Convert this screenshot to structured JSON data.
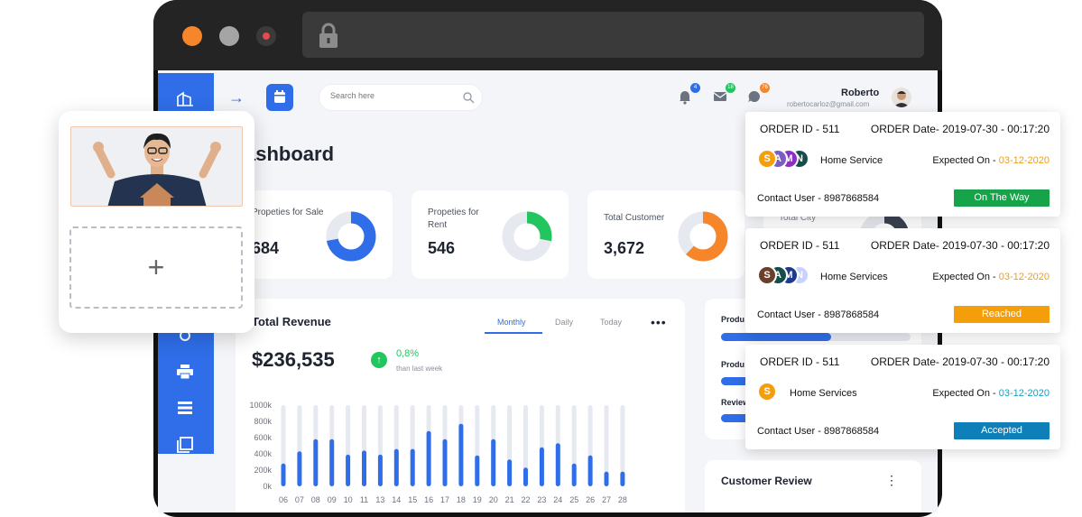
{
  "window": {
    "lock_icon": "lock-icon"
  },
  "header": {
    "search_placeholder": "Search here",
    "notifications": {
      "bell_badge": "4",
      "mail_badge": "18",
      "chat_badge": "76"
    },
    "user": {
      "name": "Roberto",
      "email": "robertocarloz@gmail.com"
    }
  },
  "page": {
    "title": "ashboard"
  },
  "stats": [
    {
      "label": "Propeties for Sale",
      "value": "684",
      "donut_fraction": 0.72,
      "color": "#2f6ee8"
    },
    {
      "label": "Propeties for Rent",
      "value": "546",
      "donut_fraction": 0.28,
      "color": "#22c55e"
    },
    {
      "label": "Total Customer",
      "value": "3,672",
      "donut_fraction": 0.62,
      "color": "#f7852a"
    }
  ],
  "partial_stat_label": "Total City",
  "revenue": {
    "title": "Total Revenue",
    "tabs": [
      "Monthly",
      "Daily",
      "Today"
    ],
    "active_tab": "Monthly",
    "amount": "$236,535",
    "change": "0,8%",
    "change_note": "than last week"
  },
  "chart_data": {
    "type": "bar",
    "categories": [
      "06",
      "07",
      "08",
      "09",
      "10",
      "11",
      "13",
      "14",
      "15",
      "16",
      "17",
      "18",
      "19",
      "20",
      "21",
      "22",
      "23",
      "24",
      "25",
      "26",
      "27",
      "28"
    ],
    "values": [
      280,
      430,
      580,
      580,
      390,
      440,
      390,
      460,
      460,
      680,
      580,
      770,
      380,
      580,
      330,
      230,
      480,
      530,
      280,
      380,
      180,
      180
    ],
    "yticks": [
      "0k",
      "200k",
      "400k",
      "600k",
      "800k",
      "1000k"
    ],
    "ylim": [
      0,
      1000
    ],
    "series_color": "#2f6ee8",
    "track_color": "#e6e9ef"
  },
  "products": {
    "labels": [
      "Produ",
      "Produ",
      "Review"
    ],
    "fractions": [
      0.58,
      0.3,
      0.3
    ]
  },
  "customer_review": {
    "title": "Customer Review"
  },
  "upload": {
    "plus": "+"
  },
  "orders": [
    {
      "id": "ORDER ID - 511",
      "date": "ORDER  Date- 2019-07-30 - 00:17:20",
      "avatars": [
        {
          "letter": "S",
          "color": "#f59e0b"
        },
        {
          "letter": "A",
          "color": "#7c5cc4"
        },
        {
          "letter": "M",
          "color": "#8b2fc9"
        },
        {
          "letter": "N",
          "color": "#134e4a"
        }
      ],
      "service": "Home Service",
      "expected_label": "Expected On - ",
      "expected_date": "03-12-2020",
      "contact": "Contact User - 8987868584",
      "status": "On The Way",
      "status_color": "#16a34a"
    },
    {
      "id": "ORDER ID - 511",
      "date": "ORDER  Date- 2019-07-30 - 00:17:20",
      "avatars": [
        {
          "letter": "S",
          "color": "#6b3f2a"
        },
        {
          "letter": "A",
          "color": "#134e4a"
        },
        {
          "letter": "M",
          "color": "#1e3a8a"
        },
        {
          "letter": "N",
          "color": "#c7d2fe"
        }
      ],
      "service": "Home Services",
      "expected_label": "Expected On - ",
      "expected_date": "03-12-2020",
      "contact": "Contact User - 8987868584",
      "status": "Reached",
      "status_color": "#f59e0b"
    },
    {
      "id": "ORDER ID - 511",
      "date": "ORDER  Date- 2019-07-30 - 00:17:20",
      "avatars": [
        {
          "letter": "S",
          "color": "#f59e0b"
        }
      ],
      "service": "Home Services",
      "expected_label": "Expected On - ",
      "expected_date": "03-12-2020",
      "contact": "Contact User - 8987868584",
      "status": "Accepted",
      "status_color": "#0e7fb8"
    }
  ]
}
